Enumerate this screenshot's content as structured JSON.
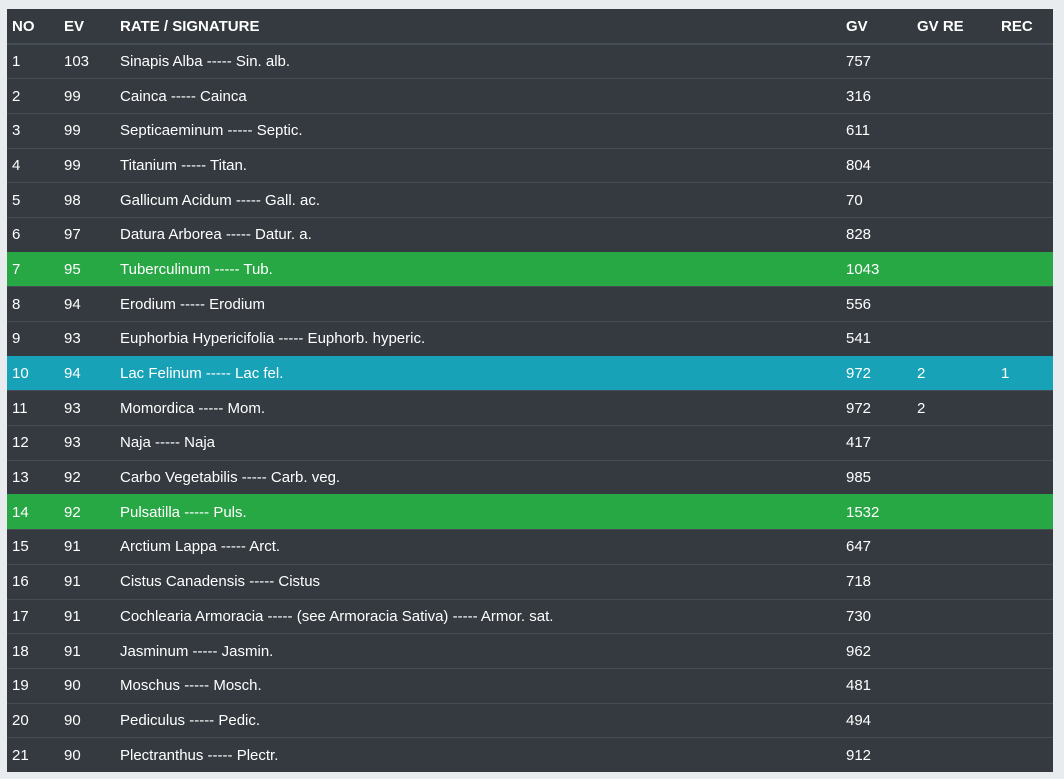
{
  "table": {
    "headers": [
      "NO",
      "EV",
      "RATE / SIGNATURE",
      "GV",
      "GV RE",
      "REC"
    ],
    "rows": [
      {
        "no": "1",
        "ev": "103",
        "name": "Sinapis Alba ----- Sin. alb.",
        "gv": "757",
        "gv_re": "",
        "rec": "",
        "highlight": ""
      },
      {
        "no": "2",
        "ev": "99",
        "name": "Cainca ----- Cainca",
        "gv": "316",
        "gv_re": "",
        "rec": "",
        "highlight": ""
      },
      {
        "no": "3",
        "ev": "99",
        "name": "Septicaeminum ----- Septic.",
        "gv": "611",
        "gv_re": "",
        "rec": "",
        "highlight": ""
      },
      {
        "no": "4",
        "ev": "99",
        "name": "Titanium ----- Titan.",
        "gv": "804",
        "gv_re": "",
        "rec": "",
        "highlight": ""
      },
      {
        "no": "5",
        "ev": "98",
        "name": "Gallicum Acidum ----- Gall. ac.",
        "gv": "70",
        "gv_re": "",
        "rec": "",
        "highlight": ""
      },
      {
        "no": "6",
        "ev": "97",
        "name": "Datura Arborea ----- Datur. a.",
        "gv": "828",
        "gv_re": "",
        "rec": "",
        "highlight": ""
      },
      {
        "no": "7",
        "ev": "95",
        "name": "Tuberculinum ----- Tub.",
        "gv": "1043",
        "gv_re": "",
        "rec": "",
        "highlight": "green"
      },
      {
        "no": "8",
        "ev": "94",
        "name": "Erodium ----- Erodium",
        "gv": "556",
        "gv_re": "",
        "rec": "",
        "highlight": ""
      },
      {
        "no": "9",
        "ev": "93",
        "name": "Euphorbia Hypericifolia ----- Euphorb. hyperic.",
        "gv": "541",
        "gv_re": "",
        "rec": "",
        "highlight": ""
      },
      {
        "no": "10",
        "ev": "94",
        "name": "Lac Felinum ----- Lac fel.",
        "gv": "972",
        "gv_re": "2",
        "rec": "1",
        "highlight": "blue"
      },
      {
        "no": "11",
        "ev": "93",
        "name": "Momordica ----- Mom.",
        "gv": "972",
        "gv_re": "2",
        "rec": "",
        "highlight": ""
      },
      {
        "no": "12",
        "ev": "93",
        "name": "Naja ----- Naja",
        "gv": "417",
        "gv_re": "",
        "rec": "",
        "highlight": ""
      },
      {
        "no": "13",
        "ev": "92",
        "name": "Carbo Vegetabilis ----- Carb. veg.",
        "gv": "985",
        "gv_re": "",
        "rec": "",
        "highlight": ""
      },
      {
        "no": "14",
        "ev": "92",
        "name": "Pulsatilla ----- Puls.",
        "gv": "1532",
        "gv_re": "",
        "rec": "",
        "highlight": "green"
      },
      {
        "no": "15",
        "ev": "91",
        "name": "Arctium Lappa ----- Arct.",
        "gv": "647",
        "gv_re": "",
        "rec": "",
        "highlight": ""
      },
      {
        "no": "16",
        "ev": "91",
        "name": "Cistus Canadensis ----- Cistus",
        "gv": "718",
        "gv_re": "",
        "rec": "",
        "highlight": ""
      },
      {
        "no": "17",
        "ev": "91",
        "name": "Cochlearia Armoracia ----- (see Armoracia Sativa) ----- Armor. sat.",
        "gv": "730",
        "gv_re": "",
        "rec": "",
        "highlight": ""
      },
      {
        "no": "18",
        "ev": "91",
        "name": "Jasminum ----- Jasmin.",
        "gv": "962",
        "gv_re": "",
        "rec": "",
        "highlight": ""
      },
      {
        "no": "19",
        "ev": "90",
        "name": "Moschus ----- Mosch.",
        "gv": "481",
        "gv_re": "",
        "rec": "",
        "highlight": ""
      },
      {
        "no": "20",
        "ev": "90",
        "name": "Pediculus ----- Pedic.",
        "gv": "494",
        "gv_re": "",
        "rec": "",
        "highlight": ""
      },
      {
        "no": "21",
        "ev": "90",
        "name": "Plectranthus ----- Plectr.",
        "gv": "912",
        "gv_re": "",
        "rec": "",
        "highlight": ""
      }
    ]
  },
  "colors": {
    "table_bg": "#343a40",
    "page_bg": "#e9ecef",
    "green_row": "#28a745",
    "blue_row": "#17a2b8"
  }
}
